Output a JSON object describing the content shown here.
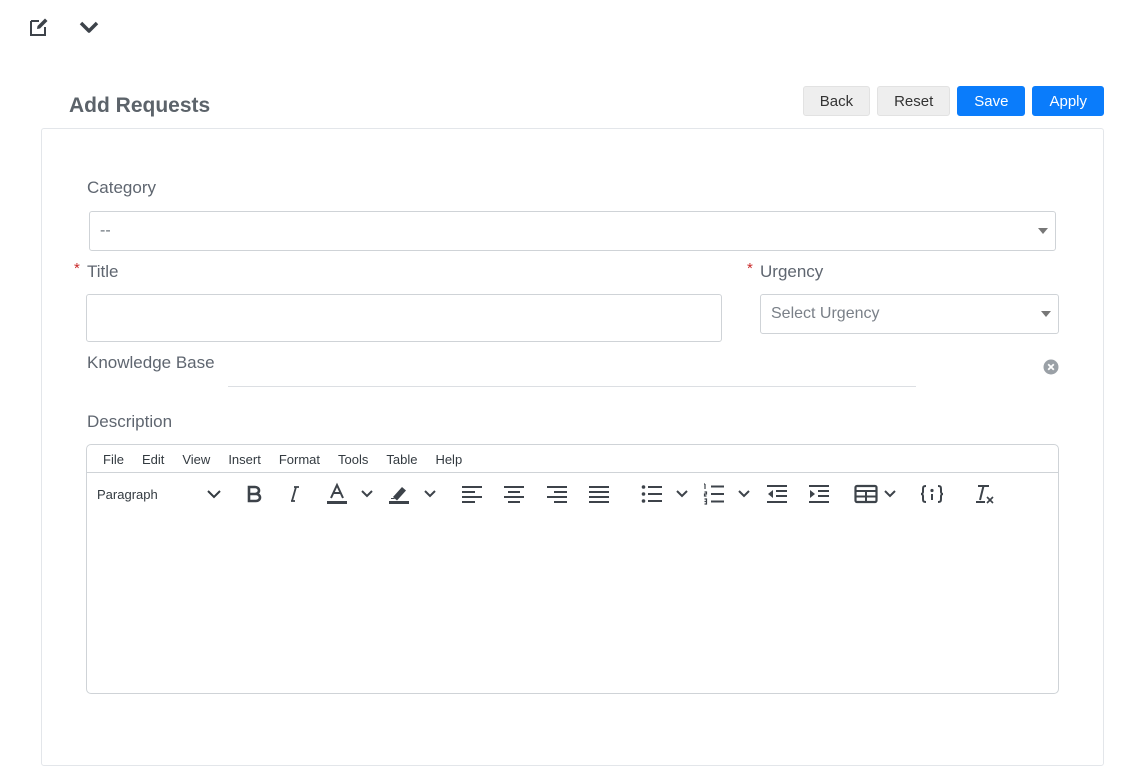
{
  "page": {
    "title": "Add Requests"
  },
  "toolbar": {
    "back_label": "Back",
    "reset_label": "Reset",
    "save_label": "Save",
    "apply_label": "Apply"
  },
  "form": {
    "category": {
      "label": "Category",
      "value": "--"
    },
    "title": {
      "label": "Title",
      "required_mark": "*",
      "value": ""
    },
    "urgency": {
      "label": "Urgency",
      "required_mark": "*",
      "placeholder": "Select Urgency"
    },
    "knowledge_base": {
      "label": "Knowledge Base",
      "value": ""
    },
    "description": {
      "label": "Description",
      "menu": [
        "File",
        "Edit",
        "View",
        "Insert",
        "Format",
        "Tools",
        "Table",
        "Help"
      ],
      "block_format": "Paragraph"
    }
  },
  "colors": {
    "primary": "#0a7cfb",
    "required": "#c92a2a",
    "icon": "#3d434a"
  },
  "icons": [
    "edit-icon",
    "chevron-down-icon",
    "clear-icon",
    "bold-icon",
    "italic-icon",
    "text-color-icon",
    "highlight-icon",
    "align-left-icon",
    "align-center-icon",
    "align-right-icon",
    "justify-icon",
    "bullet-list-icon",
    "numbered-list-icon",
    "outdent-icon",
    "indent-icon",
    "table-icon",
    "code-icon",
    "clear-format-icon"
  ]
}
